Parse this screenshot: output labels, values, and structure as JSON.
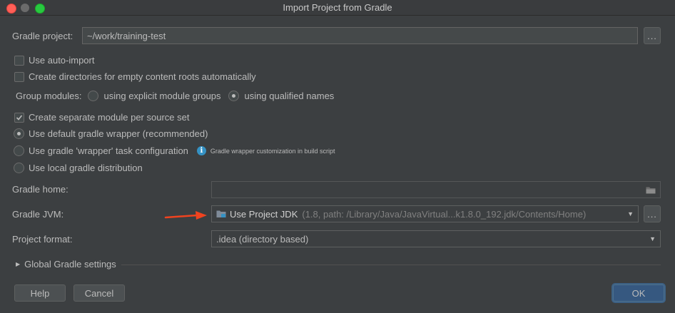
{
  "window": {
    "title": "Import Project from Gradle"
  },
  "gradle_project": {
    "label": "Gradle project:",
    "value": "~/work/training-test",
    "browse": "..."
  },
  "options": {
    "auto_import": {
      "label": "Use auto-import",
      "checked": false
    },
    "create_dirs": {
      "label": "Create directories for empty content roots automatically",
      "checked": false
    }
  },
  "group_modules": {
    "label": "Group modules:",
    "explicit": "using explicit module groups",
    "qualified": "using qualified names",
    "selected": "qualified"
  },
  "separate_module": {
    "label": "Create separate module per source set",
    "checked": true
  },
  "wrapper": {
    "default_label": "Use default gradle wrapper (recommended)",
    "task_label": "Use gradle 'wrapper' task configuration",
    "task_hint": "Gradle wrapper customization in build script",
    "local_label": "Use local gradle distribution",
    "selected": "default"
  },
  "gradle_home": {
    "label": "Gradle home:",
    "value": ""
  },
  "gradle_jvm": {
    "label": "Gradle JVM:",
    "value": "Use Project JDK",
    "detail": "(1.8, path: /Library/Java/JavaVirtual...k1.8.0_192.jdk/Contents/Home)",
    "browse": "..."
  },
  "project_format": {
    "label": "Project format:",
    "value": ".idea (directory based)"
  },
  "global_settings": {
    "label": "Global Gradle settings"
  },
  "buttons": {
    "help": "Help",
    "cancel": "Cancel",
    "ok": "OK"
  },
  "colors": {
    "accent": "#365880",
    "annotation_arrow": "#f0431f",
    "info": "#3592c4"
  }
}
